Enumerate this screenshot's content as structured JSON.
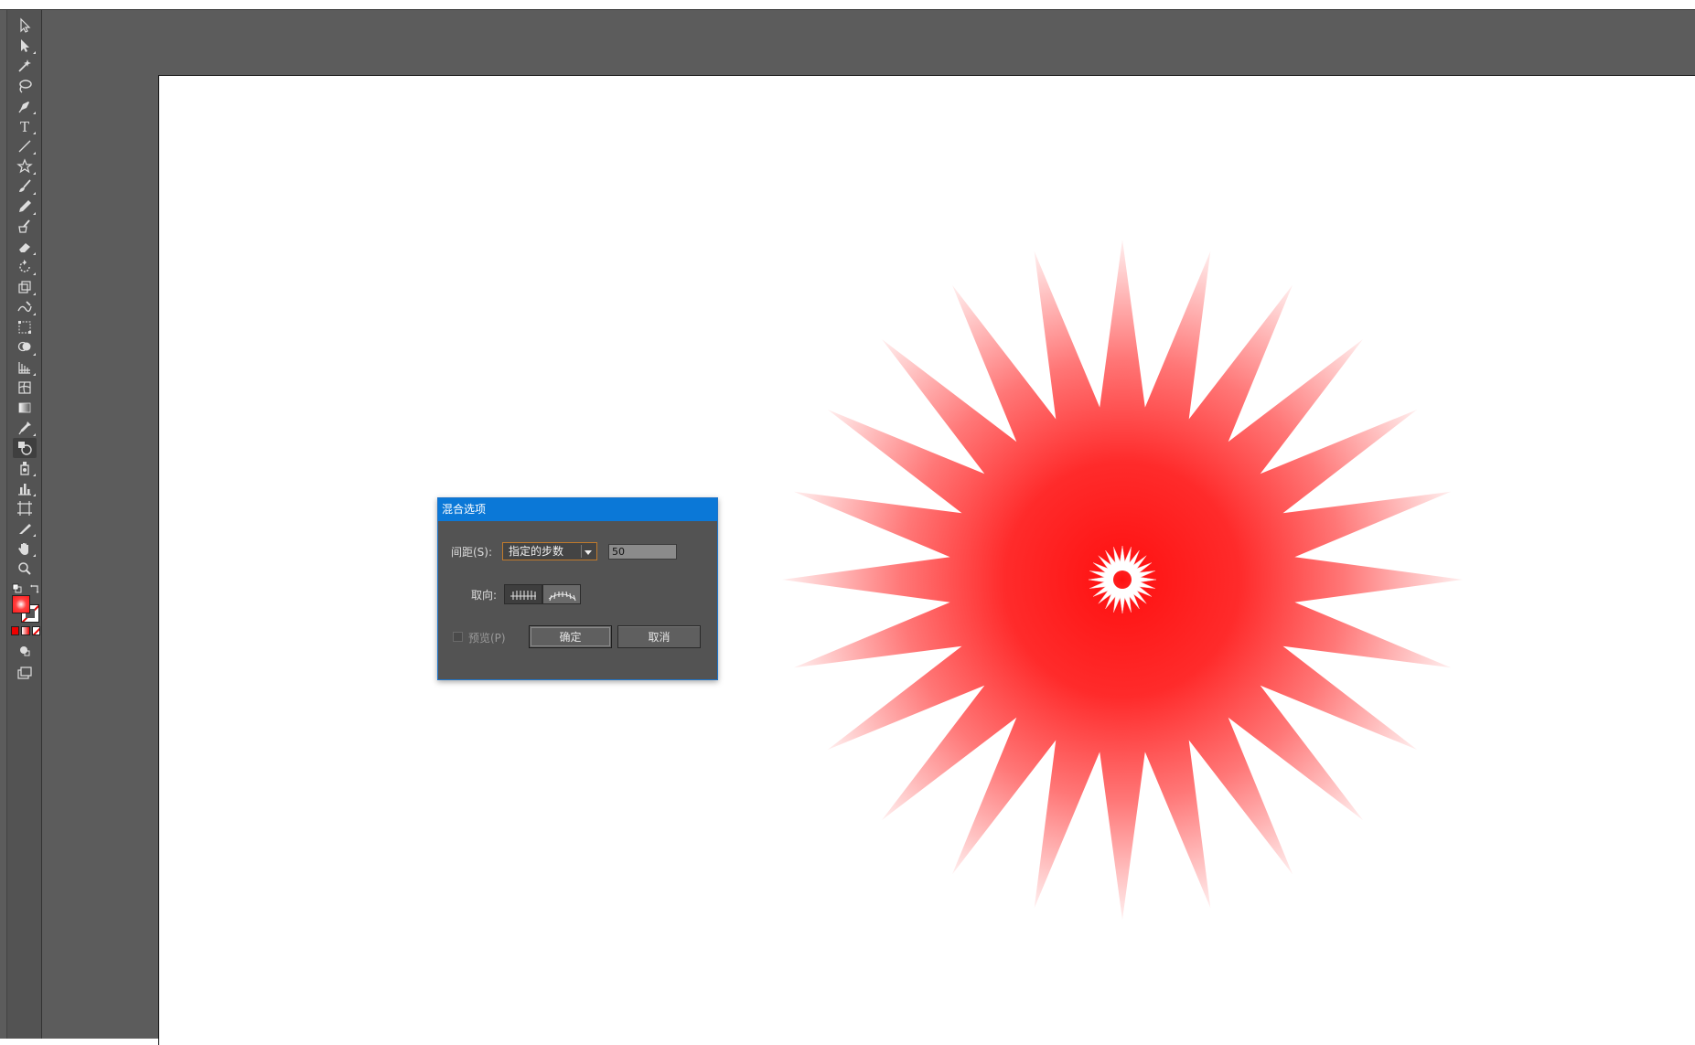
{
  "dialog": {
    "title": "混合选项",
    "spacing_label": "间距(S):",
    "spacing_value": "指定的步数",
    "steps_value": "50",
    "orientation_label": "取向:",
    "preview_label": "预览(P)",
    "preview_checked": false,
    "ok_label": "确定",
    "cancel_label": "取消"
  },
  "toolbar": {
    "tools": [
      "selection-tool-icon",
      "direct-selection-tool-icon",
      "magic-wand-tool-icon",
      "lasso-tool-icon",
      "pen-tool-icon",
      "type-tool-icon",
      "line-segment-tool-icon",
      "star-tool-icon",
      "paintbrush-tool-icon",
      "pencil-tool-icon",
      "blob-brush-tool-icon",
      "eraser-tool-icon",
      "rotate-tool-icon",
      "scale-tool-icon",
      "warp-tool-icon",
      "free-transform-tool-icon",
      "shape-builder-tool-icon",
      "perspective-grid-tool-icon",
      "mesh-tool-icon",
      "gradient-tool-icon",
      "eyedropper-tool-icon",
      "blend-tool-icon",
      "symbol-sprayer-tool-icon",
      "column-graph-tool-icon",
      "artboard-tool-icon",
      "slice-tool-icon",
      "hand-tool-icon",
      "zoom-tool-icon"
    ],
    "active_tool": "blend-tool-icon",
    "fill_color": "#ff3b3b",
    "stroke": "none"
  },
  "artwork": {
    "star_color": "#ff1a1a",
    "star_points": 24
  }
}
